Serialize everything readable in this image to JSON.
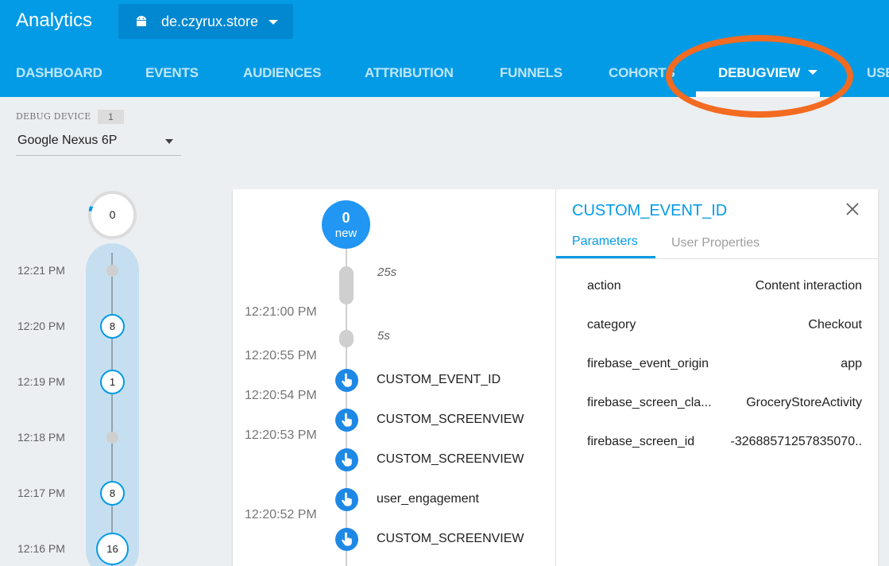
{
  "app": {
    "title": "Analytics",
    "picker_label": "de.czyrux.store"
  },
  "nav": {
    "tabs": [
      "DASHBOARD",
      "EVENTS",
      "AUDIENCES",
      "ATTRIBUTION",
      "FUNNELS",
      "COHORTS",
      "DEBUGVIEW",
      "USE"
    ],
    "active": "DEBUGVIEW"
  },
  "debug_device": {
    "label": "DEBUG DEVICE",
    "count": "1",
    "selected": "Google Nexus 6P"
  },
  "minutes_timeline": {
    "top_count": "0",
    "rows": [
      {
        "time": "12:21 PM",
        "count": null
      },
      {
        "time": "12:20 PM",
        "count": "8"
      },
      {
        "time": "12:19 PM",
        "count": "1"
      },
      {
        "time": "12:18 PM",
        "count": null
      },
      {
        "time": "12:17 PM",
        "count": "8"
      },
      {
        "time": "12:16 PM",
        "count": "16"
      }
    ]
  },
  "stream": {
    "new_count": "0",
    "new_label": "new",
    "gaps": [
      "25s",
      "5s"
    ],
    "times": [
      "12:21:00 PM",
      "12:20:55 PM",
      "12:20:54 PM",
      "12:20:53 PM",
      "12:20:52 PM"
    ],
    "events": [
      "CUSTOM_EVENT_ID",
      "CUSTOM_SCREENVIEW",
      "CUSTOM_SCREENVIEW",
      "user_engagement",
      "CUSTOM_SCREENVIEW"
    ]
  },
  "detail": {
    "title": "CUSTOM_EVENT_ID",
    "tabs": [
      "Parameters",
      "User Properties"
    ],
    "params": [
      {
        "key": "action",
        "value": "Content interaction"
      },
      {
        "key": "category",
        "value": "Checkout"
      },
      {
        "key": "firebase_event_origin",
        "value": "app"
      },
      {
        "key": "firebase_screen_cla...",
        "value": "GroceryStoreActivity"
      },
      {
        "key": "firebase_screen_id",
        "value": "-32688571257835070.."
      }
    ]
  },
  "colors": {
    "header": "#039be5",
    "accent": "#039be5",
    "annotation": "#f26b21",
    "event_icon": "#1e88e5"
  },
  "icons": {
    "app_platform": "android-icon",
    "event": "touch-icon",
    "close": "close-icon"
  }
}
